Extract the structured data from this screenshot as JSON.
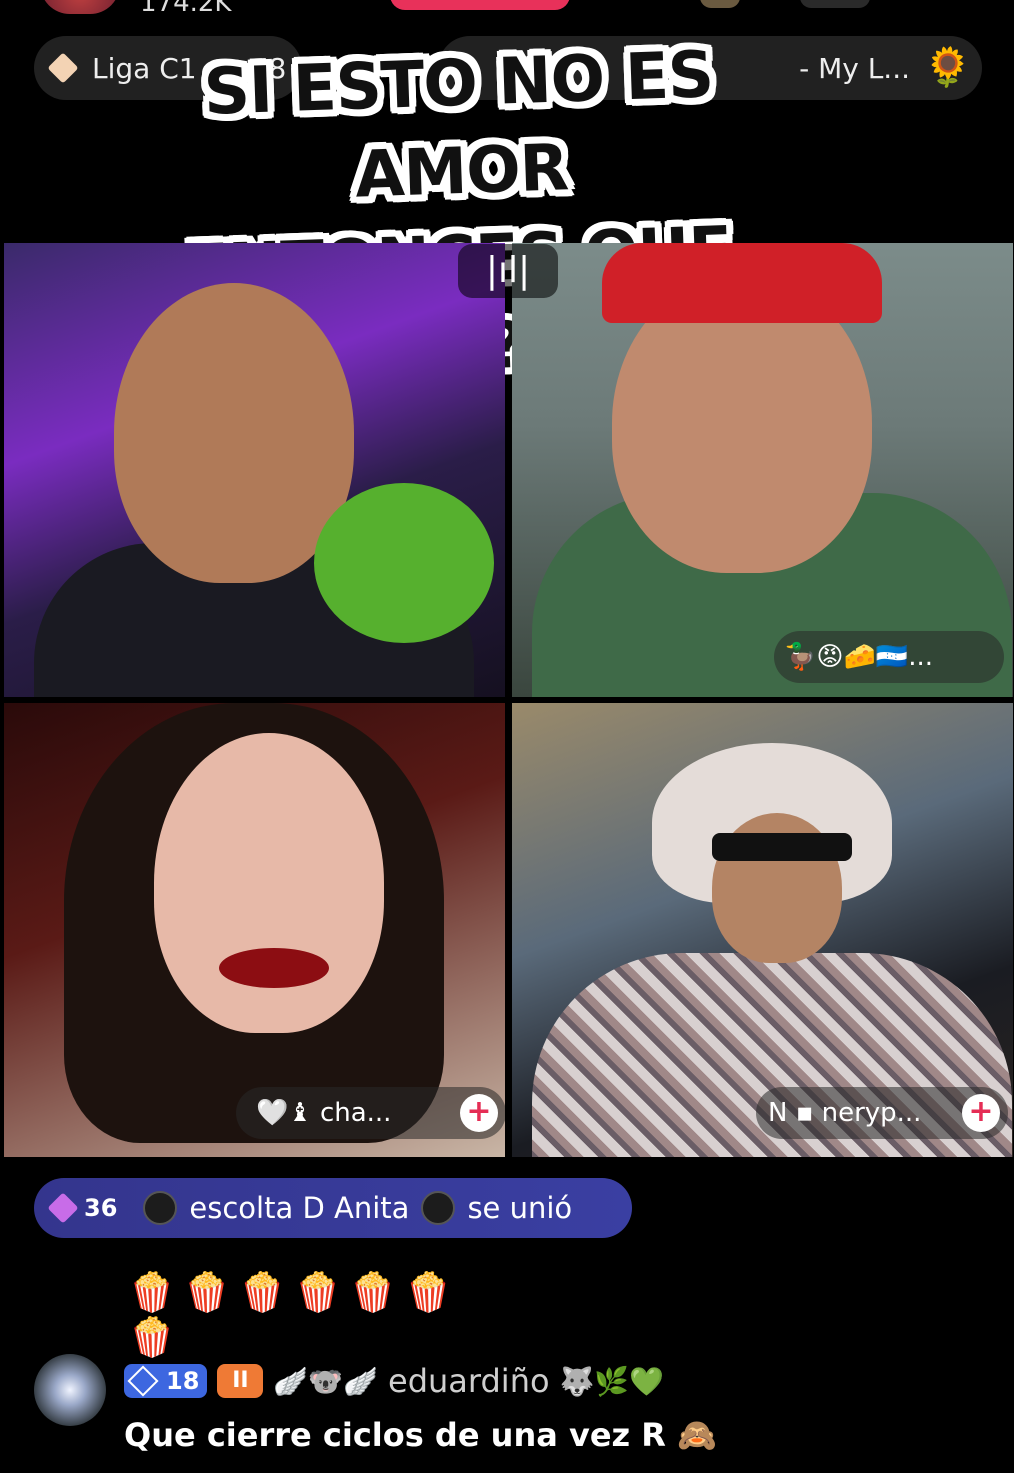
{
  "top": {
    "viewer_count": "174.2K"
  },
  "chips": {
    "left_label": "Liga C1 nro. 8",
    "right_label": "- My L...",
    "right_icon": "🌻"
  },
  "overlay": {
    "line1": "SI ESTO NO ES AMOR",
    "line2": "ENTONCES QUE ES?"
  },
  "grid": {
    "audio_icon": "|ıl|",
    "tile2_tag": "🦆😡🧀🇭🇳...",
    "tile3_tag": "🤍♝ cha...",
    "tile4_tag": "N ▪ neryp...",
    "plus": "+"
  },
  "join": {
    "level": "36",
    "name_before": "escolta D Anita",
    "suffix": "se unió"
  },
  "popcorn": "🍿🍿🍿🍿🍿🍿🍿",
  "comment": {
    "level": "18",
    "badge2": "II",
    "emojis": "🪽🐨🪽",
    "username": "eduardiño",
    "username_emojis": "🐺🌿💚",
    "text": "Que cierre ciclos de una vez R 🙈"
  },
  "colors": {
    "accent": "#e8315a",
    "join_banner": "#3a3fa2",
    "level_badge": "#3d67e0"
  }
}
